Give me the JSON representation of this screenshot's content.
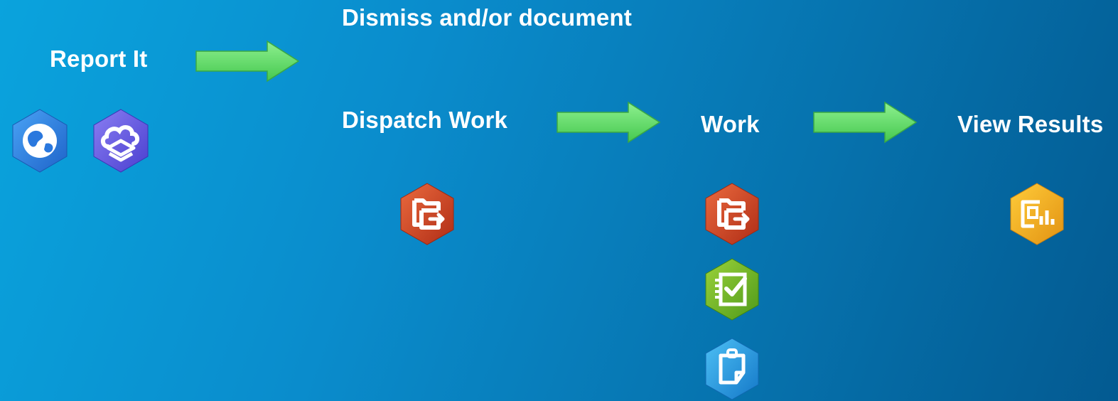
{
  "steps": {
    "report": {
      "label": "Report It"
    },
    "dismiss": {
      "label": "Dismiss and/or document"
    },
    "dispatch": {
      "label": "Dispatch Work"
    },
    "work": {
      "label": "Work"
    },
    "results": {
      "label": "View Results"
    }
  },
  "icons": [
    "globe-app-icon",
    "cloud-layers-app-icon",
    "workforce-app-icon",
    "survey-checklist-app-icon",
    "clipboard-app-icon",
    "dashboard-app-icon"
  ],
  "colors": {
    "background_start": "#0aa3dd",
    "background_end": "#035a91",
    "arrow": "#5fe06b",
    "workforce": "#d24a2a",
    "survey": "#76b82a",
    "clipboard": "#1f9be0",
    "dashboard": "#f2b01e",
    "globe": "#2f86e8",
    "cloud": "#6a5de6"
  }
}
